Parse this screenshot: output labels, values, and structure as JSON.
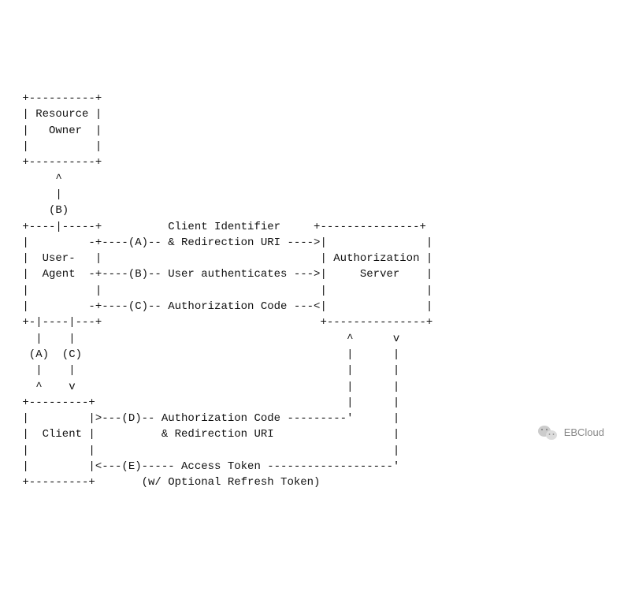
{
  "diagram": {
    "boxes": {
      "resource_owner": "Resource\n  Owner",
      "user_agent": "User-\nAgent",
      "client": "Client",
      "auth_server": "Authorization\n    Server"
    },
    "flows": {
      "A": "(A)",
      "B": "(B)",
      "C": "(C)",
      "D": "(D)",
      "E": "(E)"
    },
    "labels": {
      "a_msg": "Client Identifier",
      "a_msg2": "& Redirection URI",
      "b_msg": "User authenticates",
      "c_msg": "Authorization Code",
      "d_msg": "Authorization Code",
      "d_msg2": "& Redirection URI",
      "e_msg": "Access Token",
      "e_sub": "(w/ Optional Refresh Token)"
    }
  },
  "watermark": {
    "label": "EBCloud"
  }
}
